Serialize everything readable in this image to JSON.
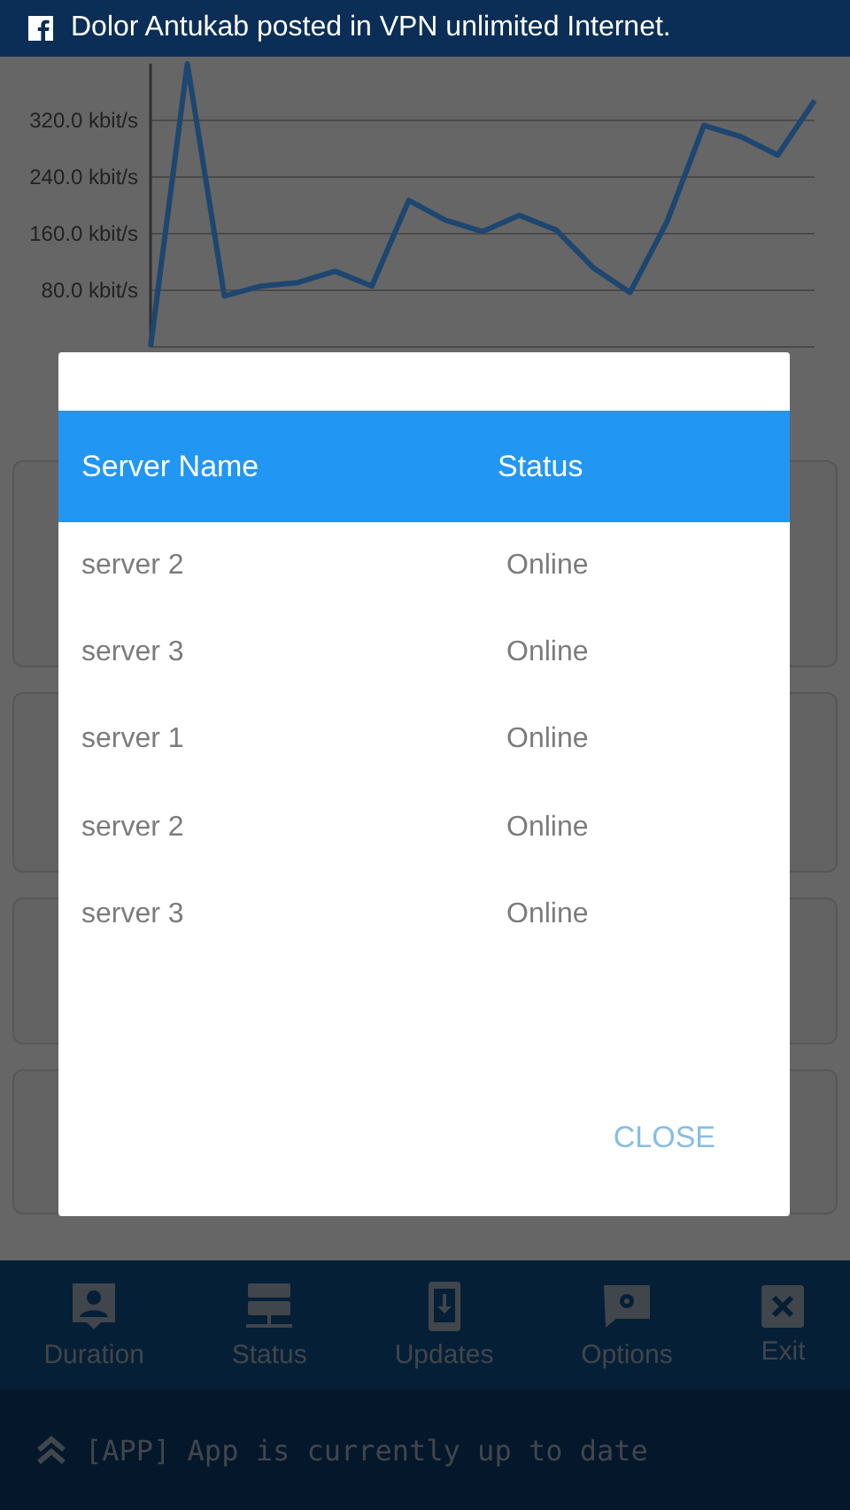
{
  "notification": {
    "text": "Dolor Antukab posted in VPN unlimited Internet."
  },
  "traffic_chart": {
    "chart_data": {
      "type": "line",
      "grid": true,
      "ylim": [
        0,
        400
      ],
      "yticks": [
        {
          "value": 80,
          "label": "80.0 kbit/s"
        },
        {
          "value": 160,
          "label": "160.0 kbit/s"
        },
        {
          "value": 240,
          "label": "240.0 kbit/s"
        },
        {
          "value": 320,
          "label": "320.0 kbit/s"
        }
      ],
      "series": [
        {
          "color": "#1d4670",
          "values": [
            0,
            400,
            72,
            86,
            91,
            107,
            86,
            207,
            179,
            163,
            186,
            165,
            112,
            77,
            177,
            313,
            297,
            271,
            348
          ]
        }
      ]
    }
  },
  "dialog": {
    "columns": [
      "Server Name",
      "Status"
    ],
    "rows": [
      {
        "name": "server 2",
        "status": "Online"
      },
      {
        "name": "server 3",
        "status": "Online"
      },
      {
        "name": "server 1",
        "status": "Online"
      },
      {
        "name": "server 2",
        "status": "Online"
      },
      {
        "name": "server 3",
        "status": "Online"
      }
    ],
    "close_button": "CLOSE"
  },
  "bottom_nav": [
    {
      "kind": "duration",
      "label": "Duration"
    },
    {
      "kind": "status",
      "label": "Status"
    },
    {
      "kind": "updates",
      "label": "Updates"
    },
    {
      "kind": "options",
      "label": "Options"
    },
    {
      "kind": "exit",
      "label": "Exit"
    }
  ],
  "status_bar": {
    "text": "[APP] App is currently up to date"
  }
}
